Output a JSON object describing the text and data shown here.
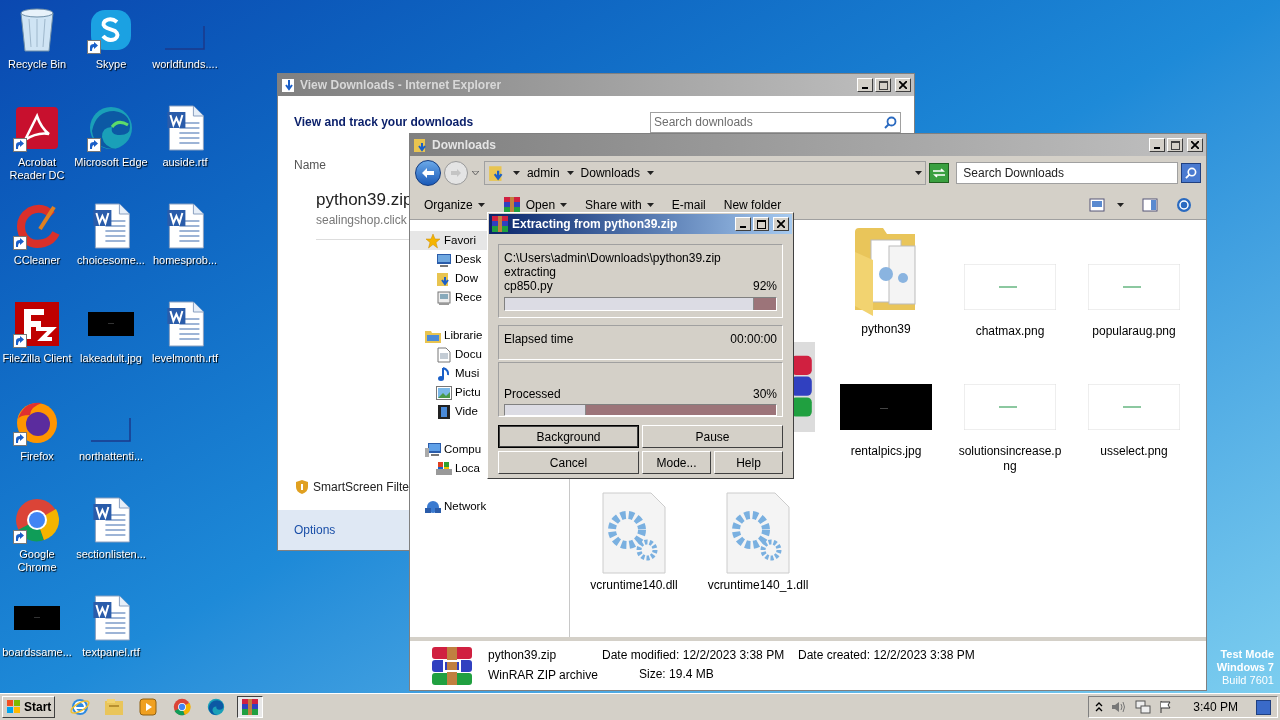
{
  "desktop": {
    "rows": [
      [
        {
          "label": "Recycle Bin",
          "kind": "recycle",
          "shortcut": false
        },
        {
          "label": "Skype",
          "kind": "skype",
          "shortcut": true
        },
        {
          "label": "worldfunds....",
          "kind": "blank",
          "shortcut": false
        }
      ],
      [
        {
          "label": "Acrobat Reader DC",
          "kind": "acrobat",
          "shortcut": true
        },
        {
          "label": "Microsoft Edge",
          "kind": "edge",
          "shortcut": true
        },
        {
          "label": "auside.rtf",
          "kind": "word",
          "shortcut": false
        }
      ],
      [
        {
          "label": "CCleaner",
          "kind": "ccleaner",
          "shortcut": true
        },
        {
          "label": "choicesome...",
          "kind": "word",
          "shortcut": false
        },
        {
          "label": "homesprob...",
          "kind": "word",
          "shortcut": false
        }
      ],
      [
        {
          "label": "FileZilla Client",
          "kind": "filezilla",
          "shortcut": true
        },
        {
          "label": "lakeadult.jpg",
          "kind": "dark",
          "shortcut": false
        },
        {
          "label": "levelmonth.rtf",
          "kind": "word",
          "shortcut": false
        }
      ],
      [
        {
          "label": "Firefox",
          "kind": "firefox",
          "shortcut": true
        },
        {
          "label": "northattenti...",
          "kind": "blank",
          "shortcut": false
        }
      ],
      [
        {
          "label": "Google Chrome",
          "kind": "chrome",
          "shortcut": true
        },
        {
          "label": "sectionlisten...",
          "kind": "word",
          "shortcut": false
        }
      ],
      [
        {
          "label": "boardssame...",
          "kind": "dark",
          "shortcut": false
        },
        {
          "label": "textpanel.rtf",
          "kind": "word",
          "shortcut": false
        }
      ]
    ]
  },
  "ie_window": {
    "title": "View Downloads - Internet Explorer",
    "heading": "View and track your downloads",
    "search_placeholder": "Search downloads",
    "column_header": "Name",
    "download": {
      "file": "python39.zip",
      "source": "sealingshop.click"
    },
    "smartscreen": "SmartScreen Filte",
    "options": "Options"
  },
  "explorer": {
    "title": "Downloads",
    "breadcrumb": [
      "admin",
      "Downloads"
    ],
    "search_placeholder": "Search Downloads",
    "toolbar": [
      {
        "label": "Organize",
        "kind": "plain",
        "dropdown": true
      },
      {
        "label": "Open",
        "kind": "winrar",
        "dropdown": true
      },
      {
        "label": "Share with",
        "kind": "plain",
        "dropdown": true
      },
      {
        "label": "E-mail",
        "kind": "plain",
        "dropdown": false
      },
      {
        "label": "New folder",
        "kind": "plain",
        "dropdown": false
      }
    ],
    "nav": [
      {
        "label": "Favori",
        "kind": "star",
        "selected": true,
        "children": [
          {
            "label": "Desk",
            "kind": "desktop",
            "selected": false
          },
          {
            "label": "Dow",
            "kind": "downloads",
            "selected": false
          },
          {
            "label": "Rece",
            "kind": "recent",
            "selected": false
          }
        ]
      },
      {
        "label": "Librarie",
        "kind": "library",
        "selected": false,
        "children": [
          {
            "label": "Docu",
            "kind": "document",
            "selected": false
          },
          {
            "label": "Musi",
            "kind": "music",
            "selected": false
          },
          {
            "label": "Pictu",
            "kind": "pictures",
            "selected": false
          },
          {
            "label": "Vide",
            "kind": "videos",
            "selected": false
          }
        ]
      },
      {
        "label": "Compu",
        "kind": "computer",
        "selected": false,
        "children": [
          {
            "label": "Loca",
            "kind": "disk",
            "selected": false
          }
        ]
      },
      {
        "label": "Network",
        "kind": "network",
        "selected": false
      }
    ],
    "file_rows": [
      [
        {
          "name": "python39",
          "kind": "folder",
          "selected": false
        },
        {
          "name": "chatmax.png",
          "selected": false
        },
        {
          "name": "popularaug.png",
          "selected": false
        }
      ],
      [
        {
          "kind": "archive",
          "selected": true
        },
        {
          "name": "rentalpics.jpg",
          "kind": "dark",
          "selected": false
        },
        {
          "name": "solutionsincrease.png",
          "selected": false
        },
        {
          "name": "usselect.png",
          "selected": false
        }
      ],
      [
        {
          "name": "vcruntime140.dll",
          "kind": "dll",
          "selected": false
        },
        {
          "name": "vcruntime140_1.dll",
          "kind": "dll",
          "selected": false
        }
      ]
    ],
    "details": {
      "name": "python39.zip",
      "type": "WinRAR ZIP archive",
      "modified_label": "Date modified:",
      "modified": "12/2/2023 3:38 PM",
      "size_label": "Size:",
      "size": "19.4 MB",
      "created_label": "Date created:",
      "created": "12/2/2023 3:38 PM"
    }
  },
  "dialog": {
    "title": "Extracting from python39.zip",
    "archive_path": "C:\\Users\\admin\\Downloads\\python39.zip",
    "action": "extracting",
    "current_file": "cp850.py",
    "file_percent": "92%",
    "file_progress": {
      "level": 0.92
    },
    "elapsed_label": "Elapsed time",
    "elapsed": "00:00:00",
    "processed_label": "Processed",
    "processed_percent": "30%",
    "processed_progress": {
      "level": 0.3
    },
    "buttons": [
      {
        "label": "Background",
        "default": true,
        "wide": true
      },
      {
        "label": "Pause",
        "default": false,
        "wide": true
      },
      {
        "label": "Cancel",
        "default": false,
        "wide": true
      },
      {
        "label": "Mode...",
        "default": false,
        "wide": false
      },
      {
        "label": "Help",
        "default": false,
        "wide": false
      }
    ]
  },
  "os_notice": [
    "Test Mode",
    "Windows 7",
    "Build 7601"
  ],
  "taskbar": {
    "start": "Start",
    "apps": [
      {
        "kind": "ie",
        "active": false
      },
      {
        "kind": "explorer",
        "active": false
      },
      {
        "kind": "media",
        "active": false
      },
      {
        "kind": "chrome",
        "active": false
      },
      {
        "kind": "edge",
        "active": false
      },
      {
        "kind": "winrar",
        "active": true
      }
    ],
    "clock": "3:40 PM"
  }
}
